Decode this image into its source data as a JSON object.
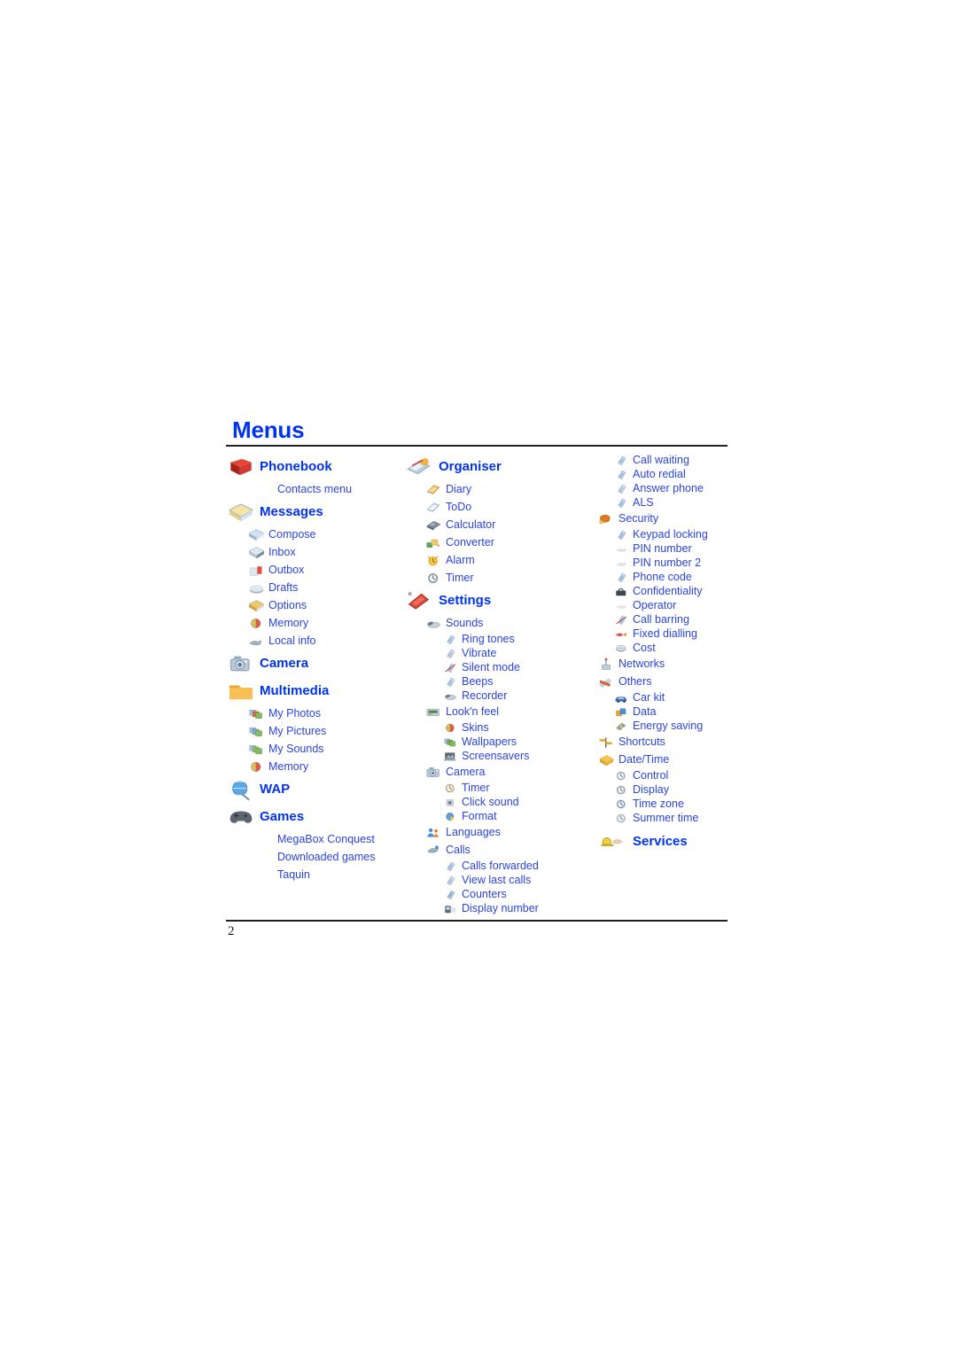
{
  "document": {
    "title": "Menus",
    "page_number": "2"
  },
  "colors": {
    "heading_blue": "#0033ee",
    "item_blue": "#2b44e0",
    "rule_black": "#231f20"
  },
  "columns": [
    {
      "name": "column-left",
      "entries": [
        {
          "level": 0,
          "label": "Phonebook",
          "icon": "phonebook-icon"
        },
        {
          "level": 1,
          "label": "Contacts menu",
          "icon": "none"
        },
        {
          "level": 0,
          "label": "Messages",
          "icon": "messages-icon"
        },
        {
          "level": 1,
          "label": "Compose",
          "icon": "compose-icon"
        },
        {
          "level": 1,
          "label": "Inbox",
          "icon": "inbox-icon"
        },
        {
          "level": 1,
          "label": "Outbox",
          "icon": "outbox-icon"
        },
        {
          "level": 1,
          "label": "Drafts",
          "icon": "drafts-icon"
        },
        {
          "level": 1,
          "label": "Options",
          "icon": "options-icon"
        },
        {
          "level": 1,
          "label": "Memory",
          "icon": "memory-icon"
        },
        {
          "level": 1,
          "label": "Local info",
          "icon": "local-info-icon"
        },
        {
          "level": 0,
          "label": "Camera",
          "icon": "camera-icon"
        },
        {
          "level": 0,
          "label": "Multimedia",
          "icon": "multimedia-icon"
        },
        {
          "level": 1,
          "label": "My Photos",
          "icon": "my-photos-icon"
        },
        {
          "level": 1,
          "label": "My Pictures",
          "icon": "my-pictures-icon"
        },
        {
          "level": 1,
          "label": "My Sounds",
          "icon": "my-sounds-icon"
        },
        {
          "level": 1,
          "label": "Memory",
          "icon": "memory-icon"
        },
        {
          "level": 0,
          "label": "WAP",
          "icon": "wap-icon"
        },
        {
          "level": 0,
          "label": "Games",
          "icon": "games-icon"
        },
        {
          "level": 1,
          "label": "MegaBox Conquest",
          "icon": "none"
        },
        {
          "level": 1,
          "label": "Downloaded games",
          "icon": "none"
        },
        {
          "level": 1,
          "label": "Taquin",
          "icon": "none"
        }
      ]
    },
    {
      "name": "column-middle",
      "entries": [
        {
          "level": 0,
          "label": "Organiser",
          "icon": "organiser-icon"
        },
        {
          "level": 1,
          "label": "Diary",
          "icon": "diary-icon"
        },
        {
          "level": 1,
          "label": "ToDo",
          "icon": "todo-icon"
        },
        {
          "level": 1,
          "label": "Calculator",
          "icon": "calculator-icon"
        },
        {
          "level": 1,
          "label": "Converter",
          "icon": "converter-icon"
        },
        {
          "level": 1,
          "label": "Alarm",
          "icon": "alarm-icon"
        },
        {
          "level": 1,
          "label": "Timer",
          "icon": "timer-icon"
        },
        {
          "level": 0,
          "label": "Settings",
          "icon": "settings-icon"
        },
        {
          "level": 1,
          "label": "Sounds",
          "icon": "sounds-icon"
        },
        {
          "level": 2,
          "label": "Ring tones",
          "icon": "ring-tones-icon"
        },
        {
          "level": 2,
          "label": "Vibrate",
          "icon": "vibrate-icon"
        },
        {
          "level": 2,
          "label": "Silent mode",
          "icon": "silent-mode-icon"
        },
        {
          "level": 2,
          "label": "Beeps",
          "icon": "beeps-icon"
        },
        {
          "level": 2,
          "label": "Recorder",
          "icon": "recorder-icon"
        },
        {
          "level": 1,
          "label": "Look'n feel",
          "icon": "looknfeel-icon"
        },
        {
          "level": 2,
          "label": "Skins",
          "icon": "skins-icon"
        },
        {
          "level": 2,
          "label": "Wallpapers",
          "icon": "wallpapers-icon"
        },
        {
          "level": 2,
          "label": "Screensavers",
          "icon": "screensavers-icon"
        },
        {
          "level": 1,
          "label": "Camera",
          "icon": "camera-settings-icon"
        },
        {
          "level": 2,
          "label": "Timer",
          "icon": "camera-timer-icon"
        },
        {
          "level": 2,
          "label": "Click sound",
          "icon": "click-sound-icon"
        },
        {
          "level": 2,
          "label": "Format",
          "icon": "format-icon"
        },
        {
          "level": 1,
          "label": "Languages",
          "icon": "languages-icon"
        },
        {
          "level": 1,
          "label": "Calls",
          "icon": "calls-icon"
        },
        {
          "level": 2,
          "label": "Calls forwarded",
          "icon": "calls-forwarded-icon"
        },
        {
          "level": 2,
          "label": "View last calls",
          "icon": "view-last-calls-icon"
        },
        {
          "level": 2,
          "label": "Counters",
          "icon": "counters-icon"
        },
        {
          "level": 2,
          "label": "Display number",
          "icon": "display-number-icon"
        }
      ]
    },
    {
      "name": "column-right",
      "entries": [
        {
          "level": 2,
          "label": "Call waiting",
          "icon": "call-waiting-icon"
        },
        {
          "level": 2,
          "label": "Auto redial",
          "icon": "auto-redial-icon"
        },
        {
          "level": 2,
          "label": "Answer phone",
          "icon": "answer-phone-icon"
        },
        {
          "level": 2,
          "label": "ALS",
          "icon": "als-icon"
        },
        {
          "level": 1,
          "label": "Security",
          "icon": "security-icon"
        },
        {
          "level": 2,
          "label": "Keypad locking",
          "icon": "keypad-locking-icon"
        },
        {
          "level": 2,
          "label": "PIN number",
          "icon": "pin-number-icon"
        },
        {
          "level": 2,
          "label": "PIN number 2",
          "icon": "pin-number-2-icon"
        },
        {
          "level": 2,
          "label": "Phone code",
          "icon": "phone-code-icon"
        },
        {
          "level": 2,
          "label": "Confidentiality",
          "icon": "confidentiality-icon"
        },
        {
          "level": 2,
          "label": "Operator",
          "icon": "operator-icon"
        },
        {
          "level": 2,
          "label": "Call barring",
          "icon": "call-barring-icon"
        },
        {
          "level": 2,
          "label": "Fixed dialling",
          "icon": "fixed-dialling-icon"
        },
        {
          "level": 2,
          "label": "Cost",
          "icon": "cost-icon"
        },
        {
          "level": 1,
          "label": "Networks",
          "icon": "networks-icon"
        },
        {
          "level": 1,
          "label": "Others",
          "icon": "others-icon"
        },
        {
          "level": 2,
          "label": "Car kit",
          "icon": "car-kit-icon"
        },
        {
          "level": 2,
          "label": "Data",
          "icon": "data-icon"
        },
        {
          "level": 2,
          "label": "Energy saving",
          "icon": "energy-saving-icon"
        },
        {
          "level": 1,
          "label": "Shortcuts",
          "icon": "shortcuts-icon"
        },
        {
          "level": 1,
          "label": "Date/Time",
          "icon": "date-time-icon"
        },
        {
          "level": 2,
          "label": "Control",
          "icon": "control-icon"
        },
        {
          "level": 2,
          "label": "Display",
          "icon": "display-icon"
        },
        {
          "level": 2,
          "label": "Time zone",
          "icon": "time-zone-icon"
        },
        {
          "level": 2,
          "label": "Summer time",
          "icon": "summer-time-icon"
        },
        {
          "level": 0,
          "label": "Services",
          "icon": "services-icon"
        }
      ]
    }
  ]
}
